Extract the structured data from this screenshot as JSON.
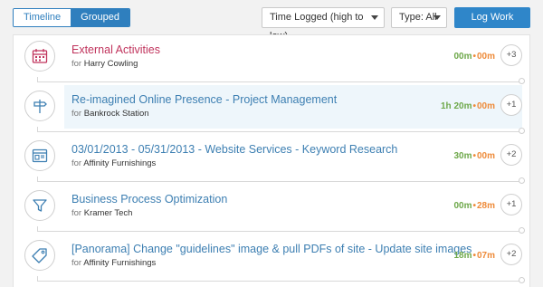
{
  "toolbar": {
    "view_tabs": [
      "Timeline",
      "Grouped"
    ],
    "sort_label": "Time Logged (high to low)",
    "type_label": "Type: All",
    "log_work_label": "Log Work"
  },
  "entries": [
    {
      "title": "External Activities",
      "for_label": "for",
      "client": "Harry Cowling",
      "time_a": "00m",
      "time_b": "00m",
      "count": "+3",
      "icon": "calendar-icon"
    },
    {
      "title": "Re-imagined Online Presence - Project Management",
      "for_label": "for",
      "client": "Bankrock Station",
      "time_a": "1h 20m",
      "time_b": "00m",
      "count": "+1",
      "icon": "signpost-icon"
    },
    {
      "title": "03/01/2013 - 05/31/2013 - Website Services - Keyword Research",
      "for_label": "for",
      "client": "Affinity Furnishings",
      "time_a": "30m",
      "time_b": "00m",
      "count": "+2",
      "icon": "browser-window-icon"
    },
    {
      "title": "Business Process Optimization",
      "for_label": "for",
      "client": "Kramer Tech",
      "time_a": "00m",
      "time_b": "28m",
      "count": "+1",
      "icon": "funnel-icon"
    },
    {
      "title": "[Panorama] Change \"guidelines\" image & pull PDFs of site - Update site images",
      "for_label": "for",
      "client": "Affinity Furnishings",
      "time_a": "18m",
      "time_b": "07m",
      "count": "+2",
      "icon": "tag-icon"
    }
  ],
  "colors": {
    "accent": "#2f86c9",
    "link": "#3d7fb2",
    "external": "#c0335c",
    "green": "#6ea84a",
    "orange": "#ee8b3a"
  }
}
